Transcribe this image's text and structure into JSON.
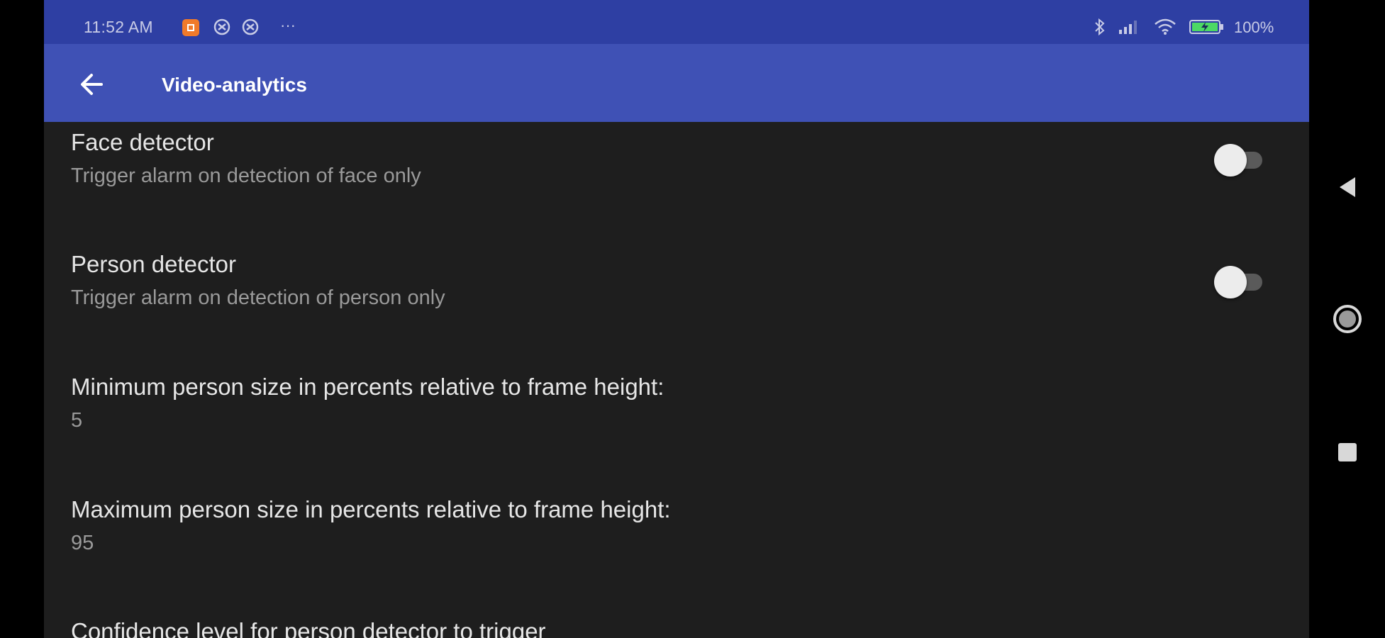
{
  "status_bar": {
    "time": "11:52 AM",
    "more_indicator": "···",
    "battery_percent": "100%",
    "icons": [
      "orange-app-notification-icon",
      "notification-icon-a",
      "notification-icon-b",
      "bluetooth-icon",
      "cell-signal-icon",
      "wifi-icon",
      "battery-charging-icon"
    ],
    "colors": {
      "background": "#2e3fa3",
      "battery_fill": "#4cd964"
    }
  },
  "app_bar": {
    "title": "Video-analytics",
    "back_icon": "arrow-left-icon",
    "color": "#3f51b5"
  },
  "preferences": [
    {
      "title": "Face detector",
      "summary": "Trigger alarm on detection of face only",
      "type": "switch",
      "checked": false
    },
    {
      "title": "Person detector",
      "summary": "Trigger alarm on detection of person only",
      "type": "switch",
      "checked": false
    },
    {
      "title": "Minimum person size in percents relative to frame height:",
      "summary": "5",
      "type": "value"
    },
    {
      "title": "Maximum person size in percents relative to frame height:",
      "summary": "95",
      "type": "value"
    },
    {
      "title": "Confidence level for person detector to trigger",
      "type": "value"
    }
  ],
  "nav_bar": {
    "icons": [
      "back-triangle-icon",
      "home-circle-icon",
      "recents-square-icon"
    ]
  }
}
